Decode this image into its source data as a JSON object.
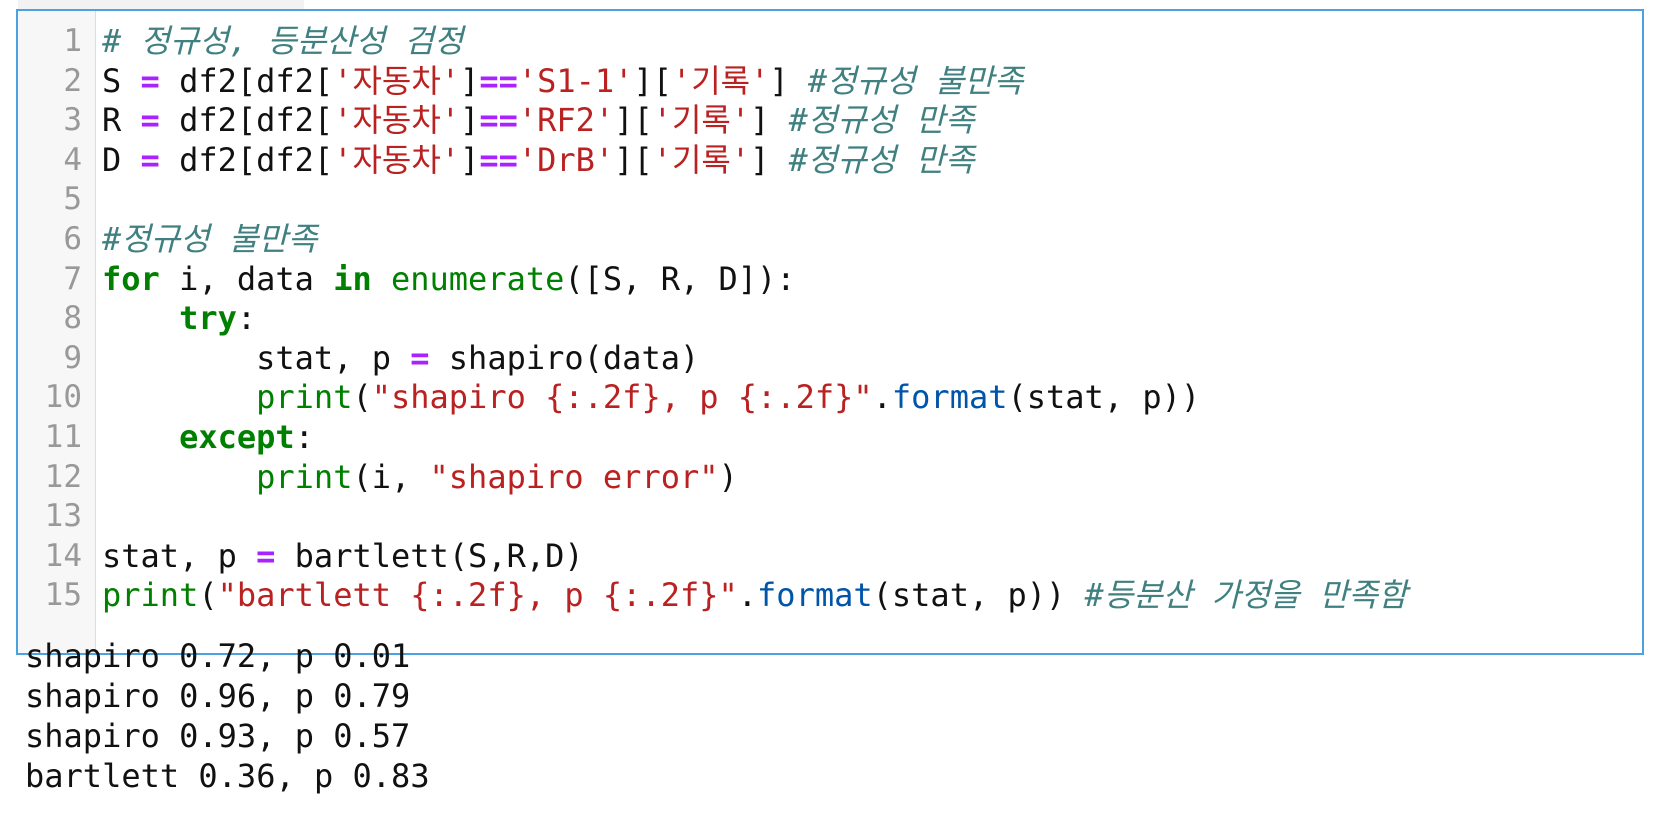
{
  "cell": {
    "lines": [
      {
        "number": "1",
        "tokens": [
          {
            "t": "comment",
            "v": "# 정규성, 등분산성 검정"
          }
        ]
      },
      {
        "number": "2",
        "tokens": [
          {
            "t": "plain",
            "v": "S "
          },
          {
            "t": "op",
            "v": "="
          },
          {
            "t": "plain",
            "v": " df2[df2["
          },
          {
            "t": "str",
            "v": "'자동차'"
          },
          {
            "t": "plain",
            "v": "]"
          },
          {
            "t": "op",
            "v": "=="
          },
          {
            "t": "str",
            "v": "'S1-1'"
          },
          {
            "t": "plain",
            "v": "]["
          },
          {
            "t": "str",
            "v": "'기록'"
          },
          {
            "t": "plain",
            "v": "] "
          },
          {
            "t": "comment",
            "v": "#정규성 불만족"
          }
        ]
      },
      {
        "number": "3",
        "tokens": [
          {
            "t": "plain",
            "v": "R "
          },
          {
            "t": "op",
            "v": "="
          },
          {
            "t": "plain",
            "v": " df2[df2["
          },
          {
            "t": "str",
            "v": "'자동차'"
          },
          {
            "t": "plain",
            "v": "]"
          },
          {
            "t": "op",
            "v": "=="
          },
          {
            "t": "str",
            "v": "'RF2'"
          },
          {
            "t": "plain",
            "v": "]["
          },
          {
            "t": "str",
            "v": "'기록'"
          },
          {
            "t": "plain",
            "v": "] "
          },
          {
            "t": "comment",
            "v": "#정규성 만족"
          }
        ]
      },
      {
        "number": "4",
        "tokens": [
          {
            "t": "plain",
            "v": "D "
          },
          {
            "t": "op",
            "v": "="
          },
          {
            "t": "plain",
            "v": " df2[df2["
          },
          {
            "t": "str",
            "v": "'자동차'"
          },
          {
            "t": "plain",
            "v": "]"
          },
          {
            "t": "op",
            "v": "=="
          },
          {
            "t": "str",
            "v": "'DrB'"
          },
          {
            "t": "plain",
            "v": "]["
          },
          {
            "t": "str",
            "v": "'기록'"
          },
          {
            "t": "plain",
            "v": "] "
          },
          {
            "t": "comment",
            "v": "#정규성 만족"
          }
        ]
      },
      {
        "number": "5",
        "tokens": []
      },
      {
        "number": "6",
        "tokens": [
          {
            "t": "comment",
            "v": "#정규성 불만족"
          }
        ]
      },
      {
        "number": "7",
        "tokens": [
          {
            "t": "kw",
            "v": "for"
          },
          {
            "t": "plain",
            "v": " i, data "
          },
          {
            "t": "kw",
            "v": "in"
          },
          {
            "t": "plain",
            "v": " "
          },
          {
            "t": "builtin",
            "v": "enumerate"
          },
          {
            "t": "plain",
            "v": "([S, R, D]):"
          }
        ]
      },
      {
        "number": "8",
        "tokens": [
          {
            "t": "plain",
            "v": "    "
          },
          {
            "t": "kw",
            "v": "try"
          },
          {
            "t": "plain",
            "v": ":"
          }
        ]
      },
      {
        "number": "9",
        "tokens": [
          {
            "t": "plain",
            "v": "        stat, p "
          },
          {
            "t": "op",
            "v": "="
          },
          {
            "t": "plain",
            "v": " shapiro(data)"
          }
        ]
      },
      {
        "number": "10",
        "tokens": [
          {
            "t": "plain",
            "v": "        "
          },
          {
            "t": "builtin",
            "v": "print"
          },
          {
            "t": "plain",
            "v": "("
          },
          {
            "t": "str",
            "v": "\"shapiro {:.2f}, p {:.2f}\""
          },
          {
            "t": "plain",
            "v": "."
          },
          {
            "t": "method",
            "v": "format"
          },
          {
            "t": "plain",
            "v": "(stat, p))"
          }
        ]
      },
      {
        "number": "11",
        "tokens": [
          {
            "t": "plain",
            "v": "    "
          },
          {
            "t": "kw",
            "v": "except"
          },
          {
            "t": "plain",
            "v": ":"
          }
        ]
      },
      {
        "number": "12",
        "tokens": [
          {
            "t": "plain",
            "v": "        "
          },
          {
            "t": "builtin",
            "v": "print"
          },
          {
            "t": "plain",
            "v": "(i, "
          },
          {
            "t": "str",
            "v": "\"shapiro error\""
          },
          {
            "t": "plain",
            "v": ")"
          }
        ]
      },
      {
        "number": "13",
        "tokens": []
      },
      {
        "number": "14",
        "tokens": [
          {
            "t": "plain",
            "v": "stat, p "
          },
          {
            "t": "op",
            "v": "="
          },
          {
            "t": "plain",
            "v": " bartlett(S,R,D)"
          }
        ]
      },
      {
        "number": "15",
        "tokens": [
          {
            "t": "builtin",
            "v": "print"
          },
          {
            "t": "plain",
            "v": "("
          },
          {
            "t": "str",
            "v": "\"bartlett {:.2f}, p {:.2f}\""
          },
          {
            "t": "plain",
            "v": "."
          },
          {
            "t": "method",
            "v": "format"
          },
          {
            "t": "plain",
            "v": "(stat, p)) "
          },
          {
            "t": "comment",
            "v": "#등분산 가정을 만족함"
          }
        ]
      }
    ]
  },
  "output": {
    "lines": [
      "shapiro 0.72, p 0.01",
      "shapiro 0.96, p 0.79",
      "shapiro 0.93, p 0.57",
      "bartlett 0.36, p 0.83"
    ]
  },
  "colors": {
    "cell_border": "#4aa3e0",
    "comment": "#408080",
    "keyword": "#008000",
    "operator": "#aa22ff",
    "string": "#ba2121",
    "method": "#0055aa"
  }
}
